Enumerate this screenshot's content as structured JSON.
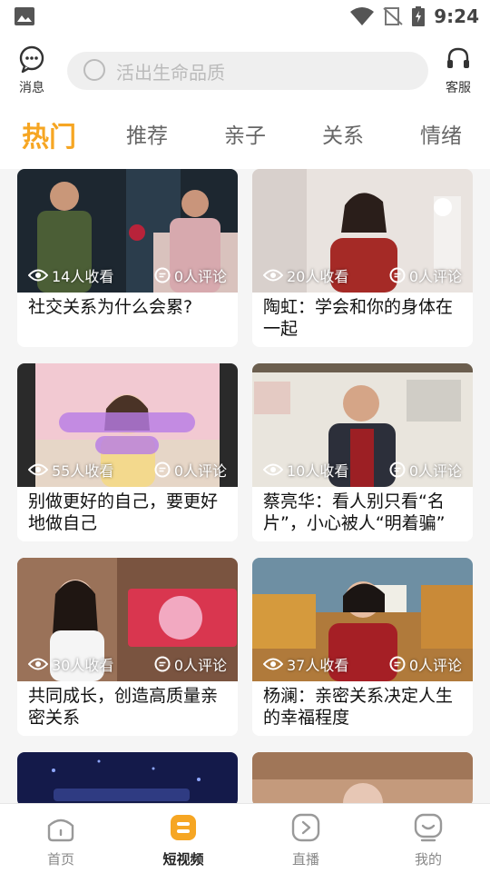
{
  "status_bar": {
    "time": "9:24"
  },
  "header": {
    "message_label": "消息",
    "search_placeholder": "活出生命品质",
    "service_label": "客服"
  },
  "tabs": [
    {
      "label": "热门",
      "active": true
    },
    {
      "label": "推荐",
      "active": false
    },
    {
      "label": "亲子",
      "active": false
    },
    {
      "label": "关系",
      "active": false
    },
    {
      "label": "情绪",
      "active": false
    }
  ],
  "cards": [
    {
      "views": "14人收看",
      "comments": "0人评论",
      "title": "社交关系为什么会累?"
    },
    {
      "views": "20人收看",
      "comments": "0人评论",
      "title": "陶虹：学会和你的身体在一起"
    },
    {
      "views": "55人收看",
      "comments": "0人评论",
      "title": "别做更好的自己，要更好地做自己"
    },
    {
      "views": "10人收看",
      "comments": "0人评论",
      "title": "蔡亮华：看人别只看“名片”，小心被人“明着骗”"
    },
    {
      "views": "30人收看",
      "comments": "0人评论",
      "title": "共同成长，创造高质量亲密关系"
    },
    {
      "views": "37人收看",
      "comments": "0人评论",
      "title": "杨澜：亲密关系决定人生的幸福程度"
    }
  ],
  "bottom_nav": [
    {
      "label": "首页",
      "active": false
    },
    {
      "label": "短视频",
      "active": true
    },
    {
      "label": "直播",
      "active": false
    },
    {
      "label": "我的",
      "active": false
    }
  ],
  "colors": {
    "accent": "#f6a623",
    "text": "#222222",
    "muted": "#888888"
  }
}
